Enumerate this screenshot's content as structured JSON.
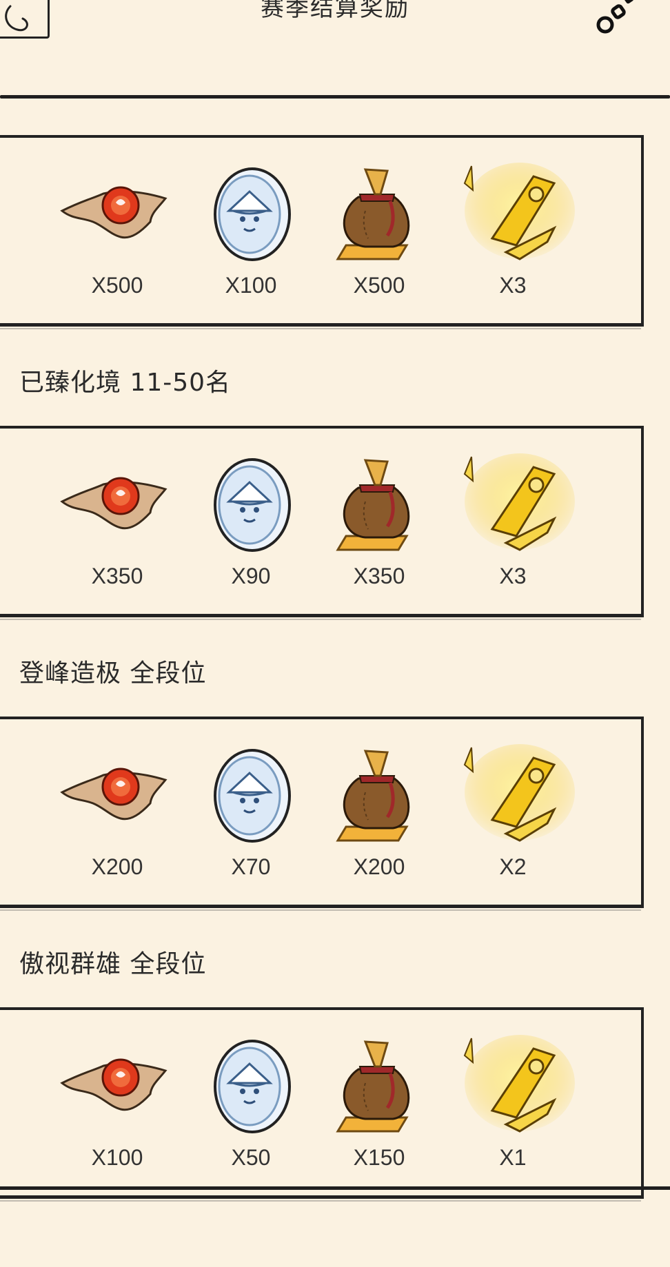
{
  "header": {
    "title": "赛季结算奖励",
    "back_icon": "scroll-back-icon",
    "settings_icon": "chain-settings-icon"
  },
  "tiers": [
    {
      "label": "",
      "items": [
        {
          "icon": "red-orb-on-cloth-icon",
          "qty": "X500"
        },
        {
          "icon": "silver-hat-coin-icon",
          "qty": "X100"
        },
        {
          "icon": "money-bag-gold-bar-icon",
          "qty": "X500"
        },
        {
          "icon": "golden-blade-shards-icon",
          "qty": "X3"
        }
      ]
    },
    {
      "label": "已臻化境 11-50名",
      "items": [
        {
          "icon": "red-orb-on-cloth-icon",
          "qty": "X350"
        },
        {
          "icon": "silver-hat-coin-icon",
          "qty": "X90"
        },
        {
          "icon": "money-bag-gold-bar-icon",
          "qty": "X350"
        },
        {
          "icon": "golden-blade-shards-icon",
          "qty": "X3"
        }
      ]
    },
    {
      "label": "登峰造极 全段位",
      "items": [
        {
          "icon": "red-orb-on-cloth-icon",
          "qty": "X200"
        },
        {
          "icon": "silver-hat-coin-icon",
          "qty": "X70"
        },
        {
          "icon": "money-bag-gold-bar-icon",
          "qty": "X200"
        },
        {
          "icon": "golden-blade-shards-icon",
          "qty": "X2"
        }
      ]
    },
    {
      "label": "傲视群雄 全段位",
      "items": [
        {
          "icon": "red-orb-on-cloth-icon",
          "qty": "X100"
        },
        {
          "icon": "silver-hat-coin-icon",
          "qty": "X50"
        },
        {
          "icon": "money-bag-gold-bar-icon",
          "qty": "X150"
        },
        {
          "icon": "golden-blade-shards-icon",
          "qty": "X1"
        }
      ]
    }
  ],
  "colors": {
    "background": "#fbf2e1",
    "ink": "#1f1f1f",
    "orb": "#e0391c",
    "coin": "#dce9f7",
    "bag": "#8a5a2b",
    "gold": "#f3c51c"
  }
}
